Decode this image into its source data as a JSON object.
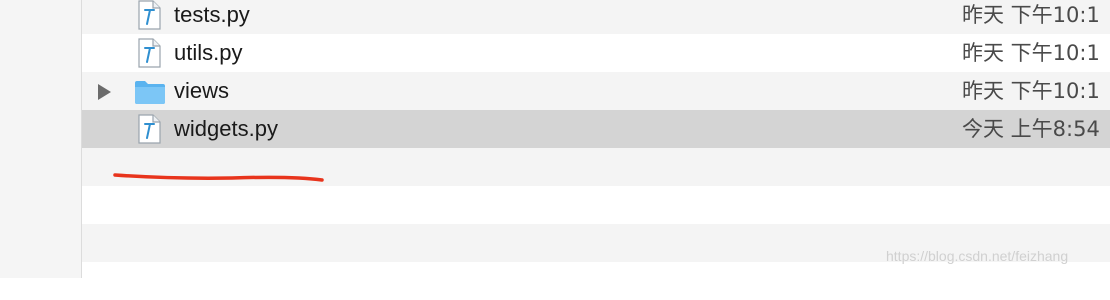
{
  "files": [
    {
      "name": "tests.py",
      "date": "昨天 下午10:1",
      "kind": "python-file"
    },
    {
      "name": "utils.py",
      "date": "昨天 下午10:1",
      "kind": "python-file"
    },
    {
      "name": "views",
      "date": "昨天 下午10:1",
      "kind": "folder"
    },
    {
      "name": "widgets.py",
      "date": "今天 上午8:54",
      "kind": "python-file",
      "selected": true
    }
  ],
  "icons": {
    "python_file": "python-file-icon",
    "folder": "folder-icon",
    "disclosure": "disclosure-triangle-icon"
  },
  "colors": {
    "selected_row": "#d4d4d4",
    "stripe_row": "#f4f4f4",
    "folder_blue": "#5ab3ef",
    "annotation_red": "#e8341c"
  },
  "watermark": "https://blog.csdn.net/feizhang"
}
